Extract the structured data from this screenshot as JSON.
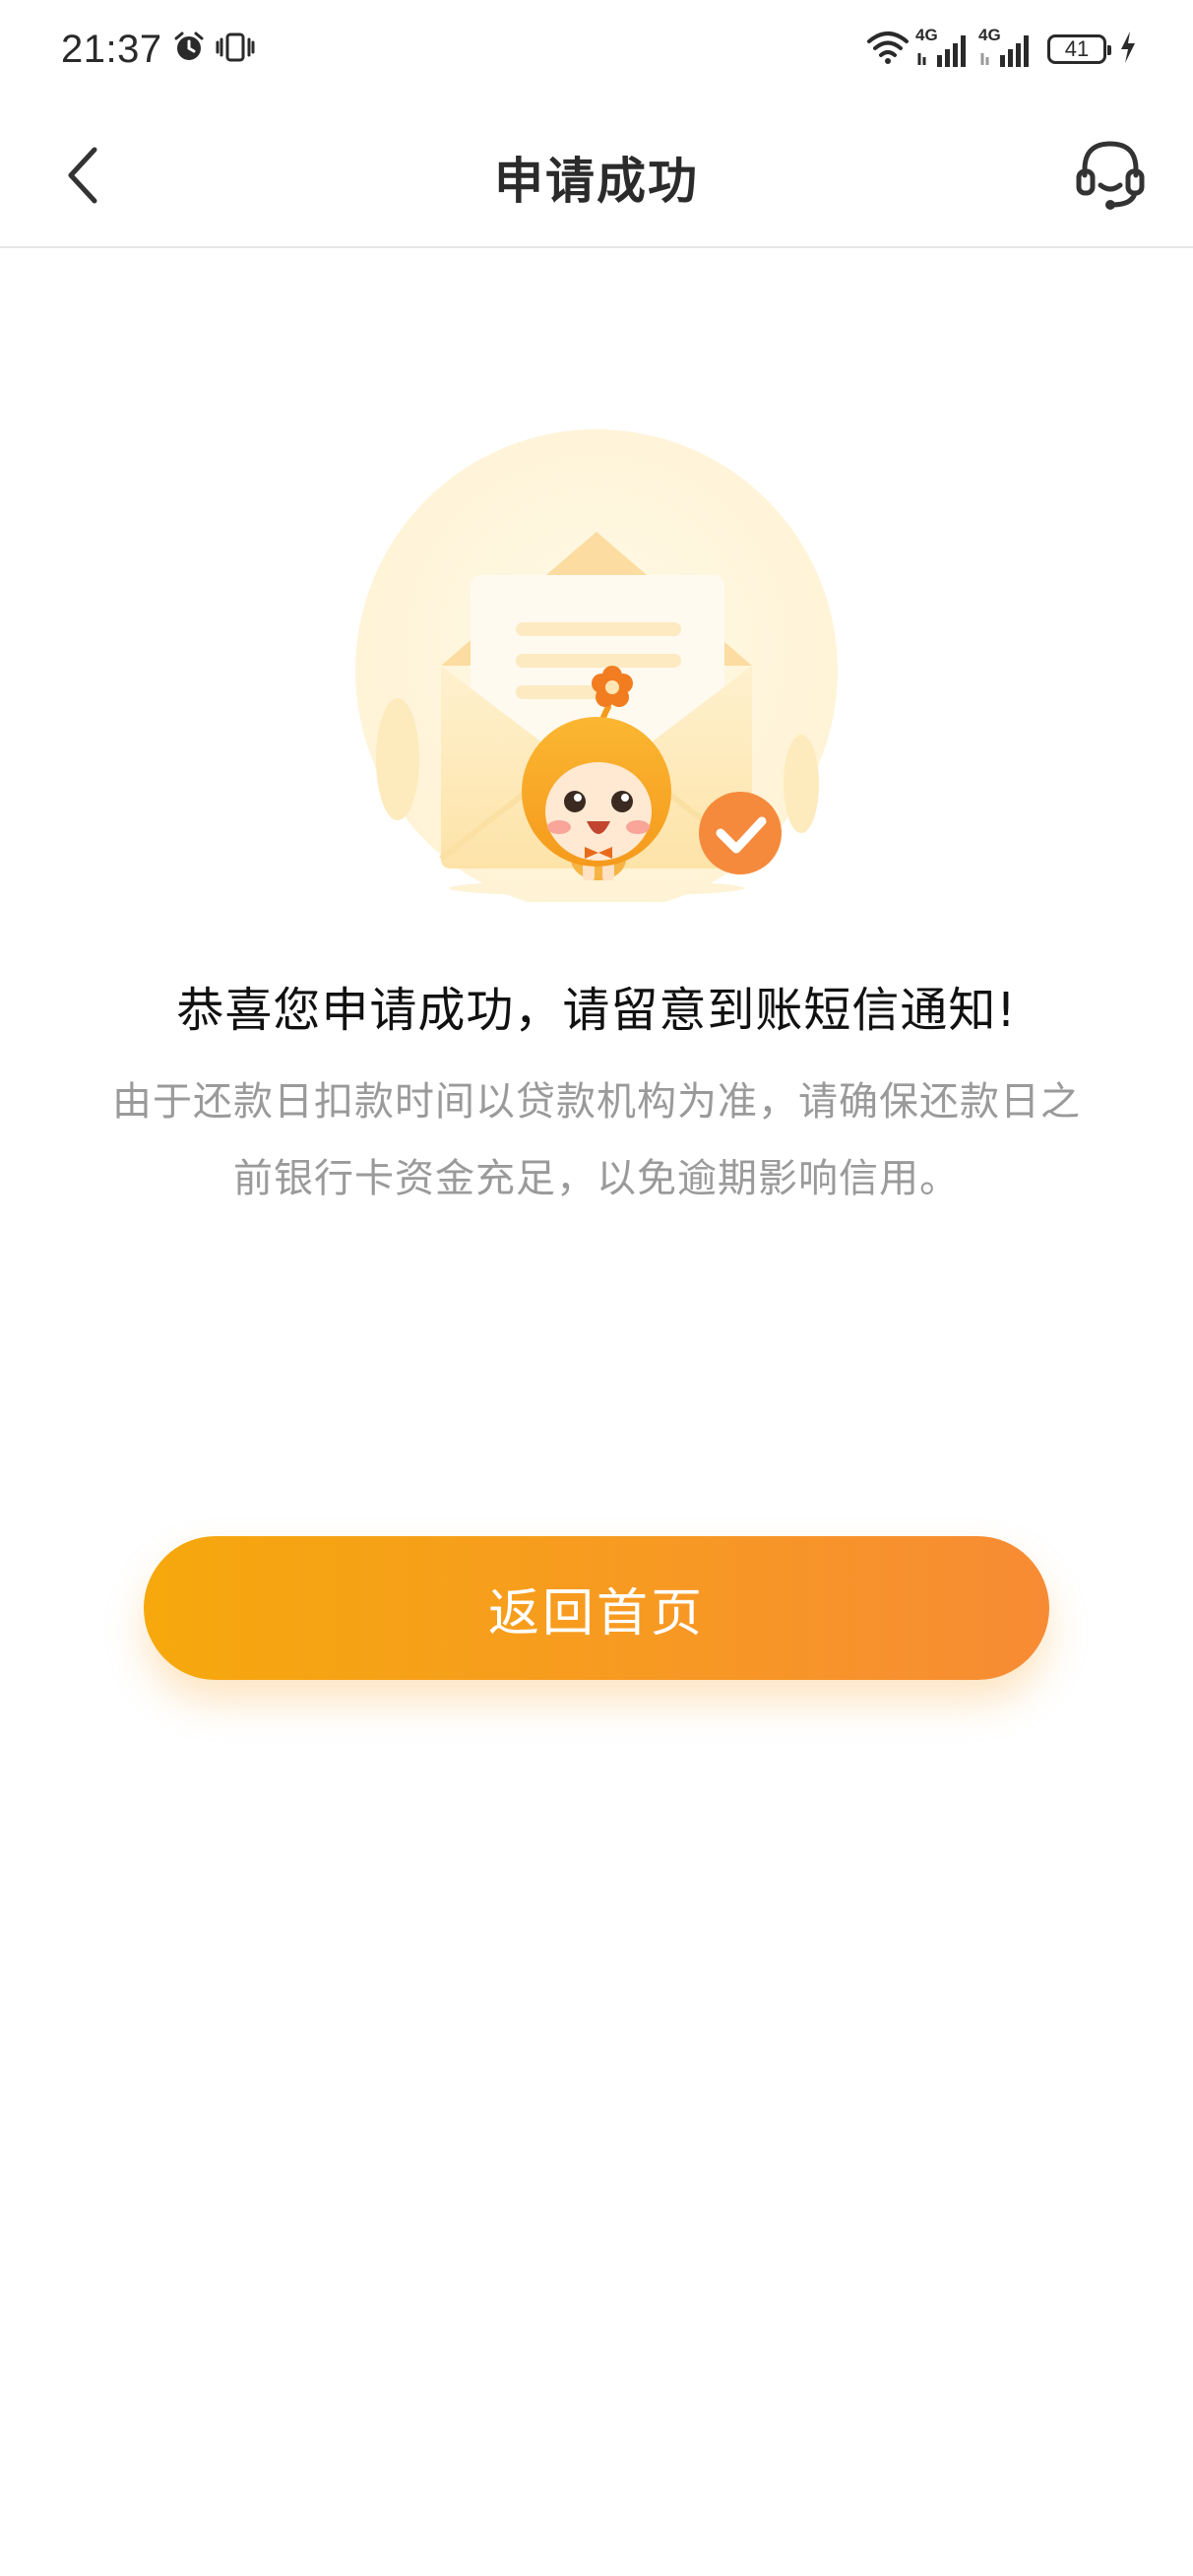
{
  "status_bar": {
    "time": "21:37",
    "network_1_label": "4G",
    "network_2_label": "4G",
    "battery_level": "41",
    "icons": [
      "alarm-icon",
      "vibrate-icon",
      "wifi-icon",
      "signal-icon",
      "signal-icon",
      "battery-icon",
      "charging-icon"
    ]
  },
  "nav": {
    "title": "申请成功",
    "back_icon": "chevron-left-icon",
    "service_icon": "headset-icon"
  },
  "illustration": {
    "icon": "envelope-mascot-success-icon",
    "accent_color": "#f7a23a"
  },
  "content": {
    "headline": "恭喜您申请成功，请留意到账短信通知!",
    "description": "由于还款日扣款时间以贷款机构为准，请确保还款日之前银行卡资金充足，以免逾期影响信用。"
  },
  "actions": {
    "home_button_label": "返回首页"
  },
  "colors": {
    "primary_gradient_start": "#f6a80c",
    "primary_gradient_end": "#f78b34",
    "description_text": "#9a9a9a"
  }
}
